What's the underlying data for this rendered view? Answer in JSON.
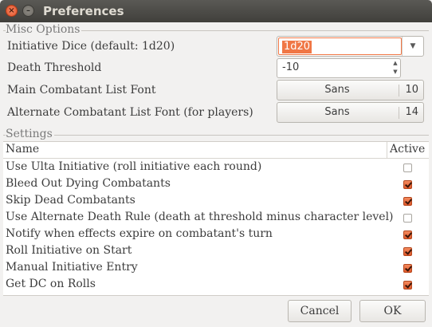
{
  "window": {
    "title": "Preferences",
    "close_glyph": "×",
    "minimize_glyph": "–"
  },
  "misc": {
    "group_label": "Misc Options",
    "initiative_dice": {
      "label": "Initiative Dice (default: 1d20)",
      "value": "1d20"
    },
    "death_threshold": {
      "label": "Death Threshold",
      "value": "-10"
    },
    "main_font": {
      "label": "Main Combatant List Font",
      "font": "Sans",
      "size": "10"
    },
    "alt_font": {
      "label": "Alternate Combatant List Font (for players)",
      "font": "Sans",
      "size": "14"
    }
  },
  "settings": {
    "group_label": "Settings",
    "columns": {
      "name": "Name",
      "active": "Active"
    },
    "rows": [
      {
        "name": "Use Ulta Initiative (roll initiative each round)",
        "active": false
      },
      {
        "name": "Bleed Out Dying Combatants",
        "active": true
      },
      {
        "name": "Skip Dead Combatants",
        "active": true
      },
      {
        "name": "Use Alternate Death Rule (death at threshold minus character level)",
        "active": false
      },
      {
        "name": "Notify when effects expire on combatant's turn",
        "active": true
      },
      {
        "name": "Roll Initiative on Start",
        "active": true
      },
      {
        "name": "Manual Initiative Entry",
        "active": true
      },
      {
        "name": "Get DC on Rolls",
        "active": true
      }
    ]
  },
  "buttons": {
    "cancel": "Cancel",
    "ok": "OK"
  },
  "colors": {
    "accent": "#f07746",
    "titlebar": "#403f3b",
    "background": "#f2f1f0"
  },
  "icons": {
    "dropdown": "▼",
    "spin_up": "▲",
    "spin_down": "▼"
  }
}
